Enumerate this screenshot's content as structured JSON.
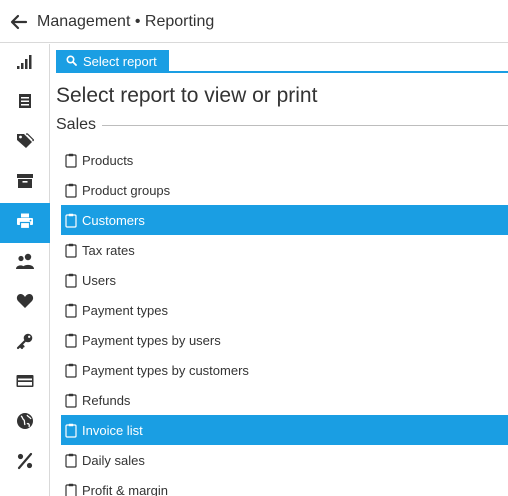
{
  "header": {
    "title": "Management • Reporting",
    "back_icon": "arrow-left-icon"
  },
  "sidebar": {
    "accent": "#1a9ee3",
    "items": [
      {
        "name": "chart-icon",
        "active": false
      },
      {
        "name": "document-list-icon",
        "active": false
      },
      {
        "name": "tags-icon",
        "active": false
      },
      {
        "name": "archive-box-icon",
        "active": false
      },
      {
        "name": "printer-icon",
        "active": true
      },
      {
        "name": "users-icon",
        "active": false
      },
      {
        "name": "heart-icon",
        "active": false
      },
      {
        "name": "key-icon",
        "active": false
      },
      {
        "name": "credit-card-icon",
        "active": false
      },
      {
        "name": "globe-icon",
        "active": false
      },
      {
        "name": "percent-icon",
        "active": false
      }
    ]
  },
  "tab": {
    "label": "Select report",
    "icon": "search-icon"
  },
  "main": {
    "heading": "Select report to view or print",
    "section": "Sales"
  },
  "reports": [
    {
      "label": "Products",
      "selected": false
    },
    {
      "label": "Product groups",
      "selected": false
    },
    {
      "label": "Customers",
      "selected": true
    },
    {
      "label": "Tax rates",
      "selected": false
    },
    {
      "label": "Users",
      "selected": false
    },
    {
      "label": "Payment types",
      "selected": false
    },
    {
      "label": "Payment types by users",
      "selected": false
    },
    {
      "label": "Payment types by customers",
      "selected": false
    },
    {
      "label": "Refunds",
      "selected": false
    },
    {
      "label": "Invoice list",
      "selected": true
    },
    {
      "label": "Daily sales",
      "selected": false
    },
    {
      "label": "Profit & margin",
      "selected": false
    }
  ]
}
